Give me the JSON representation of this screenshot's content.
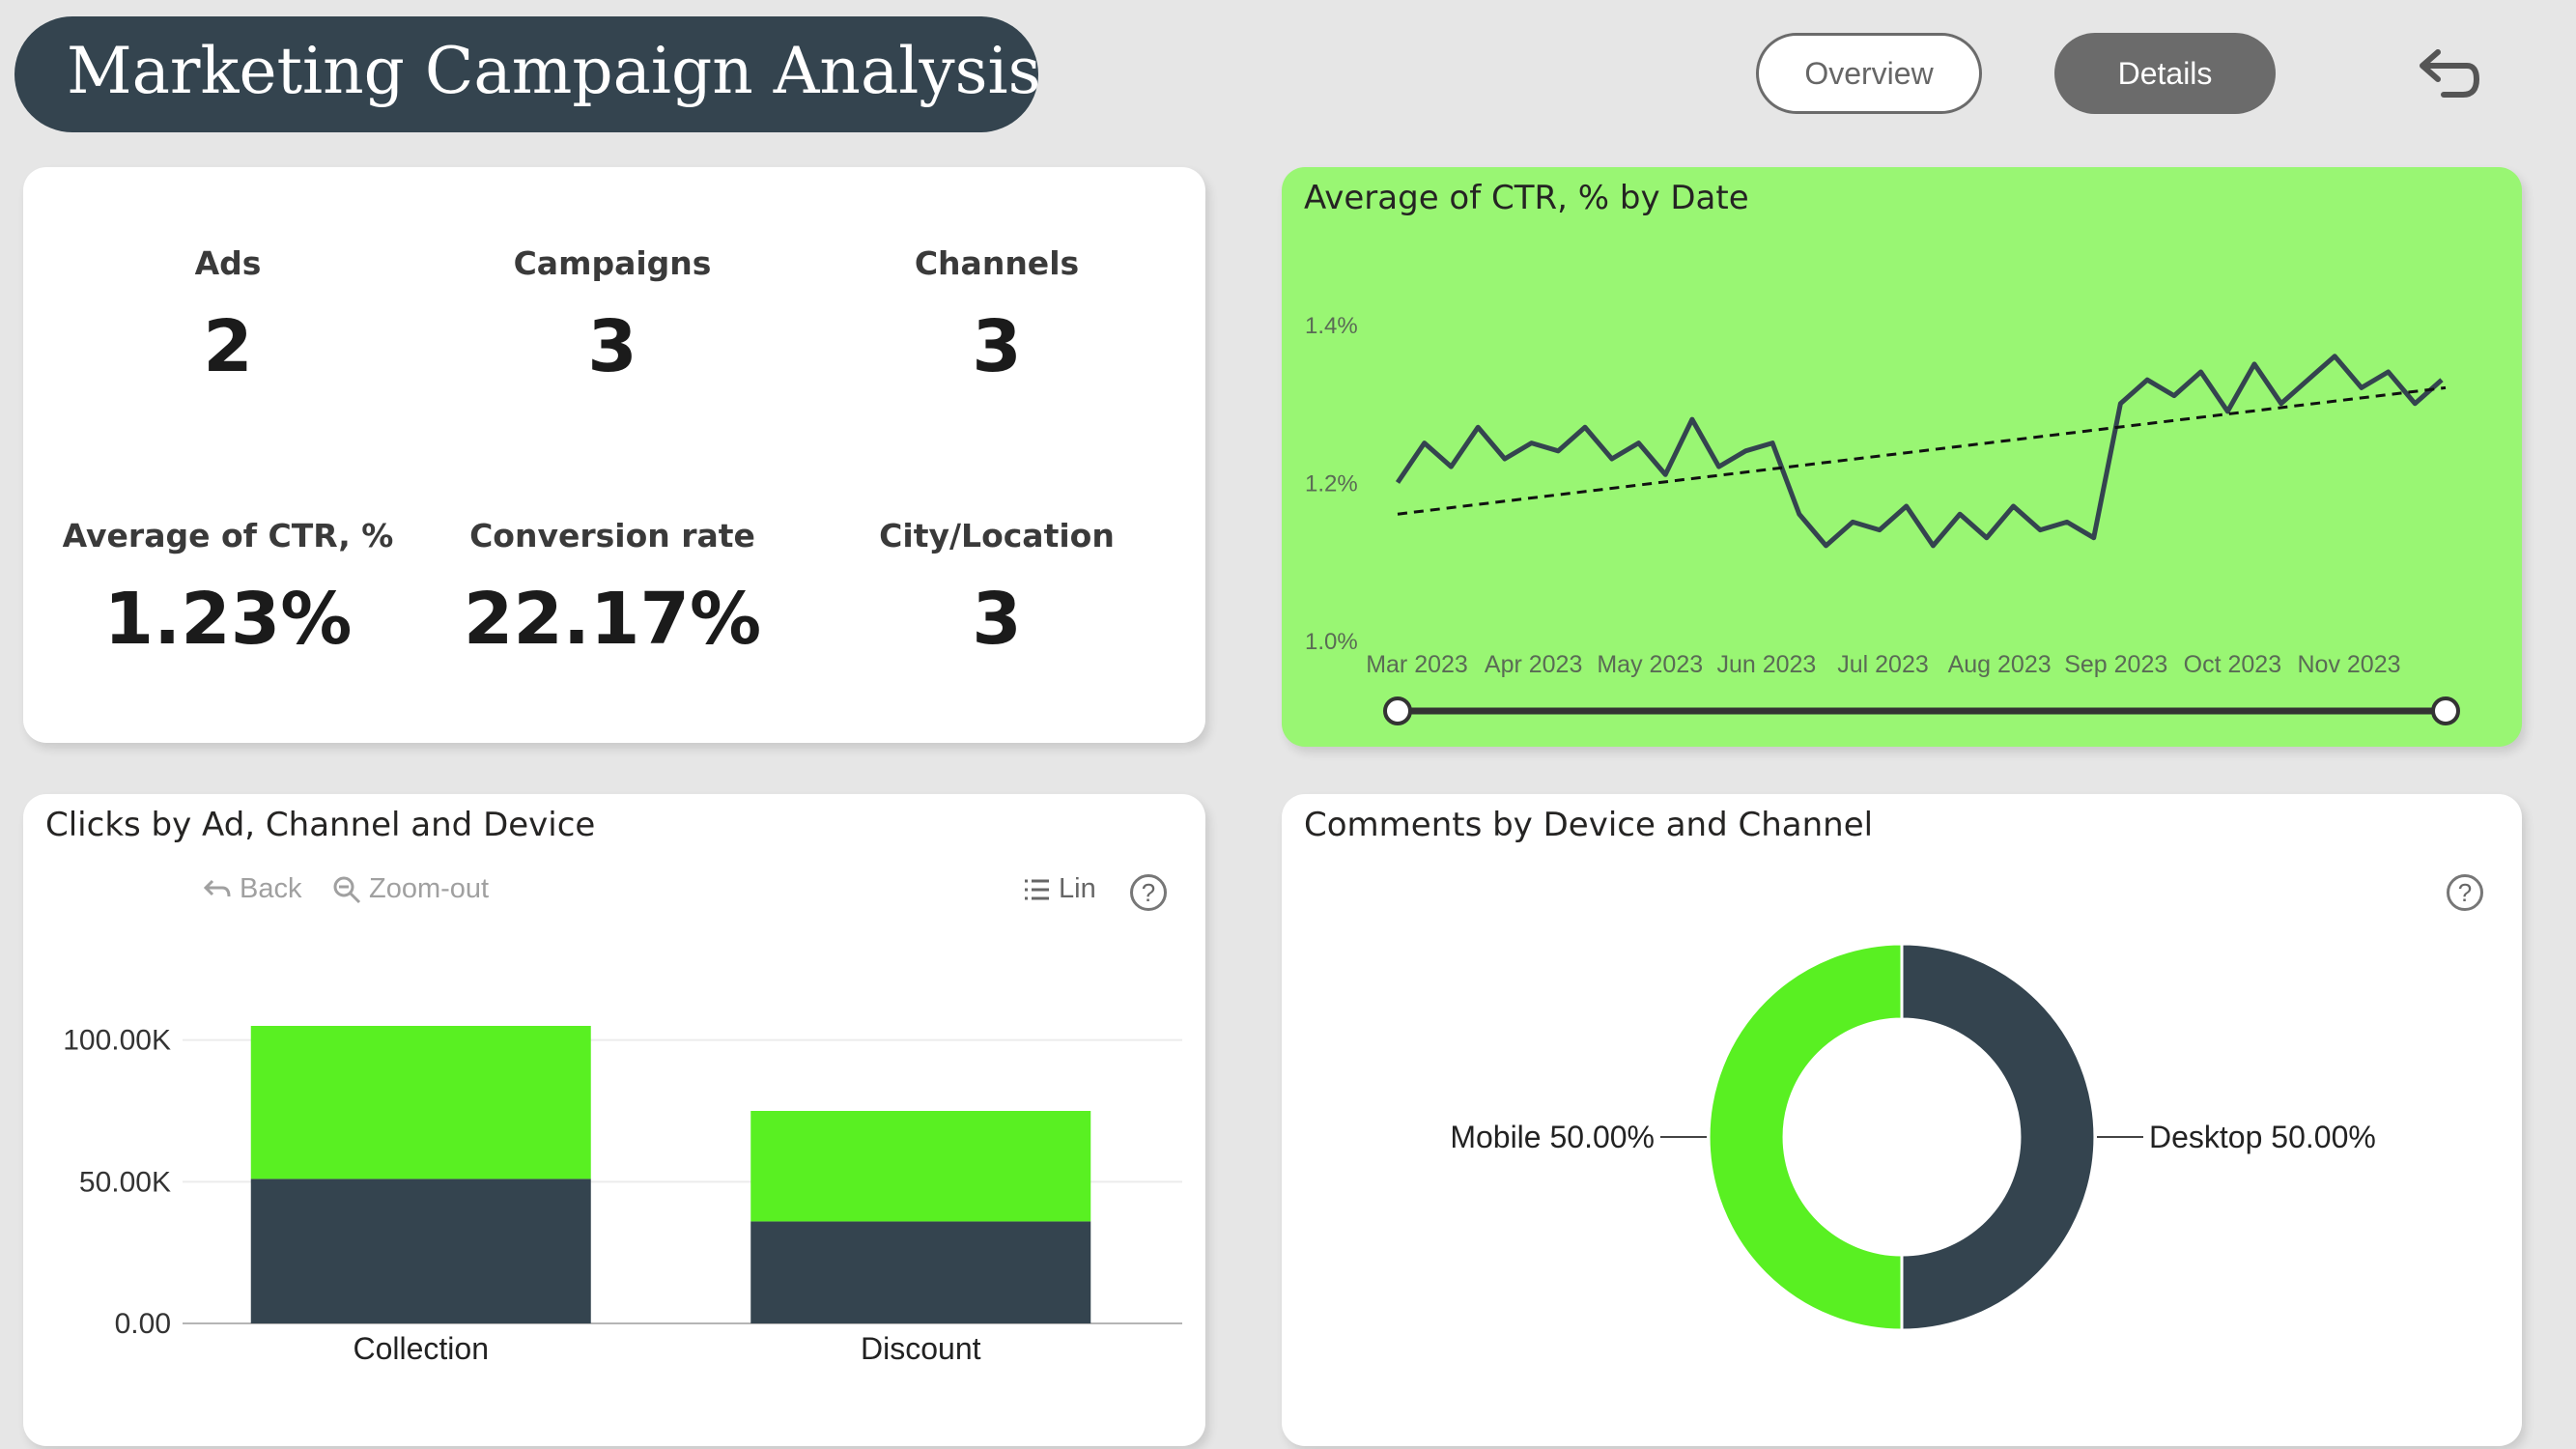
{
  "header": {
    "title": "Marketing Campaign Analysis",
    "nav": {
      "overview_label": "Overview",
      "details_label": "Details"
    }
  },
  "kpis": [
    {
      "label": "Ads",
      "value": "2"
    },
    {
      "label": "Campaigns",
      "value": "3"
    },
    {
      "label": "Channels",
      "value": "3"
    },
    {
      "label": "Average of CTR, %",
      "value": "1.23%"
    },
    {
      "label": "Conversion rate",
      "value": "22.17%"
    },
    {
      "label": "City/Location",
      "value": "3"
    }
  ],
  "clicks_visual": {
    "title": "Clicks by Ad, Channel and Device",
    "toolbar": {
      "back_label": "Back",
      "zoom_out_label": "Zoom-out",
      "lin_label": "Lin"
    }
  },
  "comments_visual": {
    "title": "Comments by Device and Channel"
  },
  "colors": {
    "dark_slate": "#34444f",
    "bright_green": "#59f022",
    "ctr_background": "#99f673"
  },
  "chart_data": [
    {
      "type": "line",
      "title": "Average of CTR, % by Date",
      "x_tick_labels": [
        "Mar 2023",
        "Apr 2023",
        "May 2023",
        "Jun 2023",
        "Jul 2023",
        "Aug 2023",
        "Sep 2023",
        "Oct 2023",
        "Nov 2023"
      ],
      "y_tick_labels": [
        "1.0%",
        "1.2%",
        "1.4%"
      ],
      "ylim": [
        1.0,
        1.4
      ],
      "x_range": [
        "2023-03-01",
        "2023-11-30"
      ],
      "series": [
        {
          "resolution": "weekly average (daily detail not readable)",
          "x": [
            "2023-03-01",
            "2023-03-08",
            "2023-03-15",
            "2023-03-22",
            "2023-03-29",
            "2023-04-05",
            "2023-04-12",
            "2023-04-19",
            "2023-04-26",
            "2023-05-03",
            "2023-05-10",
            "2023-05-17",
            "2023-05-24",
            "2023-05-31",
            "2023-06-07",
            "2023-06-14",
            "2023-06-21",
            "2023-06-28",
            "2023-07-05",
            "2023-07-12",
            "2023-07-19",
            "2023-07-26",
            "2023-08-02",
            "2023-08-09",
            "2023-08-16",
            "2023-08-23",
            "2023-08-30",
            "2023-09-06",
            "2023-09-13",
            "2023-09-20",
            "2023-09-27",
            "2023-10-04",
            "2023-10-11",
            "2023-10-18",
            "2023-10-25",
            "2023-11-01",
            "2023-11-08",
            "2023-11-15",
            "2023-11-22",
            "2023-11-29"
          ],
          "values": [
            1.2,
            1.25,
            1.22,
            1.27,
            1.23,
            1.25,
            1.24,
            1.27,
            1.23,
            1.25,
            1.21,
            1.28,
            1.22,
            1.24,
            1.25,
            1.16,
            1.12,
            1.15,
            1.14,
            1.17,
            1.12,
            1.16,
            1.13,
            1.17,
            1.14,
            1.15,
            1.13,
            1.3,
            1.33,
            1.31,
            1.34,
            1.29,
            1.35,
            1.3,
            1.33,
            1.36,
            1.32,
            1.34,
            1.3,
            1.33
          ]
        }
      ],
      "trend_line": {
        "x": [
          "2023-03-01",
          "2023-11-30"
        ],
        "y": [
          1.16,
          1.32
        ]
      },
      "range_slider": true
    },
    {
      "type": "bar",
      "stacked": true,
      "categories": [
        "Collection",
        "Discount"
      ],
      "y_tick_labels": [
        "0.00",
        "50.00K",
        "100.00K"
      ],
      "ylim": [
        0,
        120000
      ],
      "series": [
        {
          "values": [
            51000,
            36000
          ],
          "color": "#34444f"
        },
        {
          "values": [
            54000,
            39000
          ],
          "color": "#59f022"
        }
      ]
    },
    {
      "type": "pie",
      "donut": true,
      "slices": [
        {
          "label": "Mobile 50.00%",
          "value": 50.0,
          "color": "#59f022"
        },
        {
          "label": "Desktop 50.00%",
          "value": 50.0,
          "color": "#34444f"
        }
      ]
    }
  ]
}
